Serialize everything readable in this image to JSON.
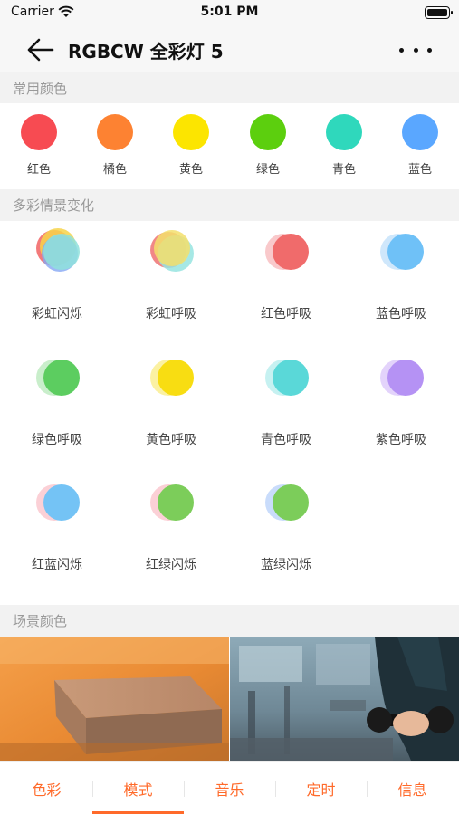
{
  "status_bar": {
    "carrier": "Carrier",
    "time": "5:01 PM"
  },
  "nav": {
    "title": "RGBCW 全彩灯 5"
  },
  "sections": {
    "common_colors": "常用颜色",
    "scene_changes": "多彩情景变化",
    "scene_colors": "场景颜色"
  },
  "common_colors": [
    {
      "label": "红色",
      "color": "#f74b52"
    },
    {
      "label": "橘色",
      "color": "#fd8232"
    },
    {
      "label": "黄色",
      "color": "#fce500"
    },
    {
      "label": "绿色",
      "color": "#5ccf0e"
    },
    {
      "label": "青色",
      "color": "#2fd8bc"
    },
    {
      "label": "蓝色",
      "color": "#5aa7ff"
    }
  ],
  "scenes": [
    {
      "label": "彩虹闪烁",
      "colors": [
        "#f26b6b",
        "#f7d34a",
        "#86a8f4",
        "#8ee0dc"
      ]
    },
    {
      "label": "彩虹呼吸",
      "colors": [
        "#f07a7a",
        "#96e4e1",
        "#f3df6c"
      ]
    },
    {
      "label": "红色呼吸",
      "colors": [
        "#f9c9cb",
        "#f06b6b"
      ]
    },
    {
      "label": "蓝色呼吸",
      "colors": [
        "#cfe7fb",
        "#6fc1f7"
      ]
    },
    {
      "label": "绿色呼吸",
      "colors": [
        "#c9eecb",
        "#5ccd60"
      ]
    },
    {
      "label": "黄色呼吸",
      "colors": [
        "#fbf1a2",
        "#f8dd12"
      ]
    },
    {
      "label": "青色呼吸",
      "colors": [
        "#c6f1f1",
        "#5ad8d8"
      ]
    },
    {
      "label": "紫色呼吸",
      "colors": [
        "#e3d3fb",
        "#b592f4"
      ]
    },
    {
      "label": "红蓝闪烁",
      "colors": [
        "#fbd0d6",
        "#74c3f5"
      ]
    },
    {
      "label": "红绿闪烁",
      "colors": [
        "#fbd0d6",
        "#7ccd5a"
      ]
    },
    {
      "label": "蓝绿闪烁",
      "colors": [
        "#c9dcfb",
        "#7ccd5a"
      ]
    }
  ],
  "tabs": [
    "色彩",
    "模式",
    "音乐",
    "定时",
    "信息"
  ],
  "active_tab": "模式",
  "accent_color": "#ff6a2a"
}
